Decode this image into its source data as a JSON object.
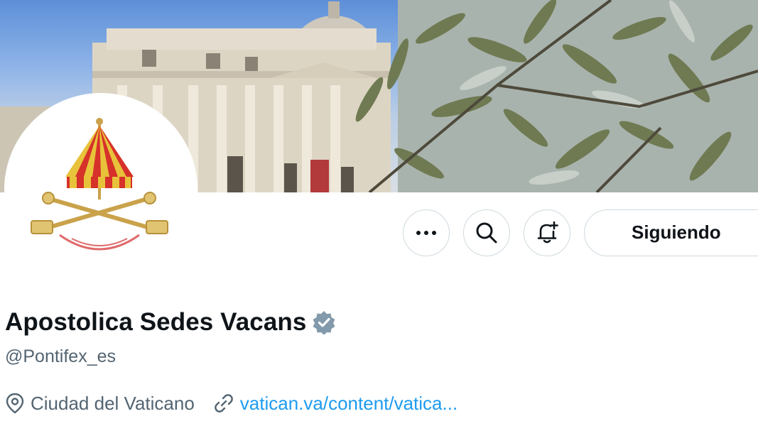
{
  "profile": {
    "display_name": "Apostolica Sedes Vacans",
    "handle": "@Pontifex_es",
    "verified": true,
    "location": "Ciudad del Vaticano",
    "website": "vatican.va/content/vatica..."
  },
  "actions": {
    "more_icon": "more-horizontal-icon",
    "search_icon": "search-icon",
    "notify_icon": "bell-plus-icon",
    "follow_label": "Siguiendo"
  },
  "icons": {
    "location": "map-pin-icon",
    "website": "link-icon",
    "verified": "verified-badge-icon",
    "avatar": "papal-umbraculum-keys-emblem",
    "banner": "st-peters-basilica-olive-branches"
  },
  "colors": {
    "link": "#1d9bf0",
    "secondary_text": "#536471",
    "primary_text": "#0f1419",
    "border": "#cfd9de",
    "verified_badge": "#829aab"
  }
}
